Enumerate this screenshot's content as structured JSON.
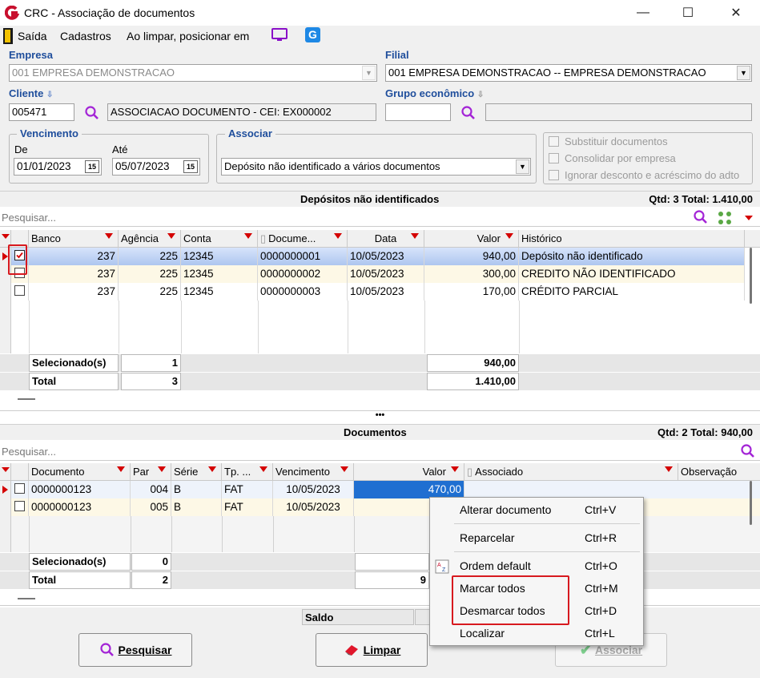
{
  "window": {
    "title": "CRC - Associação de documentos",
    "minimize": "—",
    "maximize": "☐",
    "close": "✕"
  },
  "menu": {
    "sair": "Saída",
    "cadastros": "Cadastros",
    "ao_limpar": "Ao limpar, posicionar em"
  },
  "empresa": {
    "label": "Empresa",
    "value": "001 EMPRESA DEMONSTRACAO"
  },
  "filial": {
    "label": "Filial",
    "value": "001 EMPRESA DEMONSTRACAO -- EMPRESA DEMONSTRACAO"
  },
  "cliente": {
    "label": "Cliente",
    "code": "005471",
    "name": "ASSOCIACAO DOCUMENTO - CEI: EX000002"
  },
  "grupo": {
    "label": "Grupo econômico",
    "code": "",
    "name": ""
  },
  "vencimento": {
    "label": "Vencimento",
    "de_label": "De",
    "de_value": "01/01/2023",
    "ate_label": "Até",
    "ate_value": "05/07/2023",
    "cal": "15"
  },
  "associar": {
    "label": "Associar",
    "value": "Depósito não identificado a vários documentos"
  },
  "options": [
    "Substituir documentos",
    "Consolidar por empresa",
    "Ignorar desconto e acréscimo do adto"
  ],
  "depositos": {
    "title": "Depósitos não identificados",
    "summary": "Qtd: 3 Total: 1.410,00",
    "search_placeholder": "Pesquisar...",
    "columns": [
      "Banco",
      "Agência",
      "Conta",
      "Docume...",
      "Data",
      "Valor",
      "Histórico"
    ],
    "rows": [
      {
        "checked": true,
        "banco": "237",
        "agencia": "225",
        "conta": "12345",
        "documento": "0000000001",
        "data": "10/05/2023",
        "valor": "940,00",
        "historico": "Depósito não identificado"
      },
      {
        "checked": false,
        "banco": "237",
        "agencia": "225",
        "conta": "12345",
        "documento": "0000000002",
        "data": "10/05/2023",
        "valor": "300,00",
        "historico": "CREDITO NÃO IDENTIFICADO"
      },
      {
        "checked": false,
        "banco": "237",
        "agencia": "225",
        "conta": "12345",
        "documento": "0000000003",
        "data": "10/05/2023",
        "valor": "170,00",
        "historico": "CRÉDITO PARCIAL"
      }
    ],
    "footer": {
      "sel_label": "Selecionado(s)",
      "sel_count": "1",
      "sel_valor": "940,00",
      "total_label": "Total",
      "total_count": "3",
      "total_valor": "1.410,00"
    }
  },
  "splitter": "•••",
  "documentos": {
    "title": "Documentos",
    "summary": "Qtd: 2 Total: 940,00",
    "search_placeholder": "Pesquisar...",
    "columns": [
      "Documento",
      "Par",
      "Série",
      "Tp. ...",
      "Vencimento",
      "Valor",
      "Associado",
      "Observação"
    ],
    "rows": [
      {
        "checked": false,
        "documento": "0000000123",
        "par": "004",
        "serie": "B",
        "tp": "FAT",
        "vencimento": "10/05/2023",
        "valor": "470,00"
      },
      {
        "checked": false,
        "documento": "0000000123",
        "par": "005",
        "serie": "B",
        "tp": "FAT",
        "vencimento": "10/05/2023",
        "valor": ""
      }
    ],
    "footer": {
      "sel_label": "Selecionado(s)",
      "sel_count": "0",
      "total_label": "Total",
      "total_count": "2",
      "total_valor_partial": "9"
    }
  },
  "saldo": {
    "label": "Saldo"
  },
  "buttons": {
    "pesquisar": "Pesquisar",
    "limpar": "Limpar",
    "associar": "Associar"
  },
  "context_menu": [
    {
      "label": "Alterar documento",
      "shortcut": "Ctrl+V"
    },
    {
      "label": "Reparcelar",
      "shortcut": "Ctrl+R"
    },
    {
      "label": "Ordem default",
      "shortcut": "Ctrl+O"
    },
    {
      "label": "Marcar todos",
      "shortcut": "Ctrl+M"
    },
    {
      "label": "Desmarcar todos",
      "shortcut": "Ctrl+D"
    },
    {
      "label": "Localizar",
      "shortcut": "Ctrl+L"
    }
  ],
  "colors": {
    "accent_label": "#1f4e9c",
    "filter_red": "#d40000",
    "highlight_red": "#d7191f",
    "selection_blue": "#aec6ef",
    "logo_red": "#c8102e"
  }
}
